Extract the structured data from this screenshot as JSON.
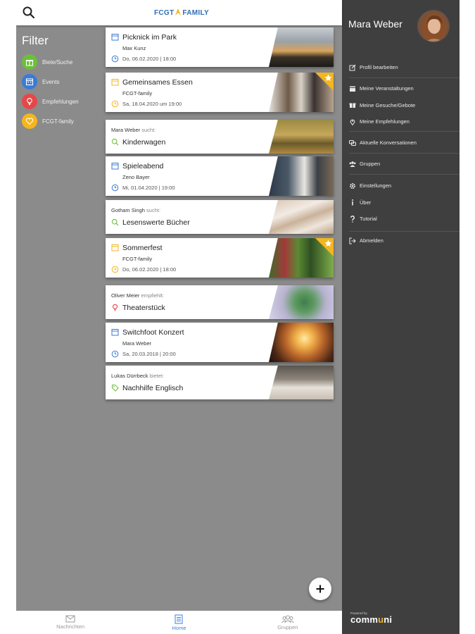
{
  "header": {
    "logo_left": "FCGT",
    "logo_right": "FAMILY",
    "search_icon": "search-icon"
  },
  "filter": {
    "title": "Filter",
    "items": [
      {
        "label": "Biete/Suche",
        "icon": "gift-icon",
        "color": "#6dbf3b"
      },
      {
        "label": "Events",
        "icon": "calendar-icon",
        "color": "#3a7bd5"
      },
      {
        "label": "Empfehlungen",
        "icon": "lightbulb-icon",
        "color": "#e54848"
      },
      {
        "label": "FCGT-family",
        "icon": "heart-icon",
        "color": "#f4b51f"
      }
    ]
  },
  "feed": [
    {
      "type": "event",
      "title": "Picknick im Park",
      "subtitle": "Max Kunz",
      "date": "Do, 06.02.2020 | 18:00"
    },
    {
      "type": "event",
      "title": "Gemeinsames Essen",
      "subtitle": "FCGT-family",
      "date": "Sa, 18.04.2020 um 19:00",
      "starred": true
    },
    {
      "type": "offer",
      "person": "Mara Weber",
      "verb": "sucht:",
      "title": "Kinderwagen"
    },
    {
      "type": "event",
      "title": "Spieleabend",
      "subtitle": "Zeno Bayer",
      "date": "Mi, 01.04.2020 | 19:00"
    },
    {
      "type": "offer",
      "person": "Gotham Singh",
      "verb": "sucht:",
      "title": "Lesenswerte Bücher"
    },
    {
      "type": "event",
      "title": "Sommerfest",
      "subtitle": "FCGT-family",
      "date": "Do, 06.02.2020 | 18:00",
      "starred": true
    },
    {
      "type": "recommend",
      "person": "Oliver Meier",
      "verb": "empfiehlt:",
      "title": "Theaterstück"
    },
    {
      "type": "event",
      "title": "Switchfoot Konzert",
      "subtitle": "Mara Weber",
      "date": "Sa, 20.03.2018 | 20:00"
    },
    {
      "type": "offer-give",
      "person": "Lukas Dürrbeck",
      "verb": "bietet:",
      "title": "Nachhilfe Englisch"
    }
  ],
  "bottom_nav": [
    {
      "label": "Nachrichten",
      "icon": "mail-icon",
      "active": false
    },
    {
      "label": "Home",
      "icon": "list-icon",
      "active": true
    },
    {
      "label": "Gruppen",
      "icon": "group-icon",
      "active": false
    }
  ],
  "drawer": {
    "user_name": "Mara Weber",
    "menu": [
      {
        "label": "Profil bearbeiten",
        "icon": "edit-icon"
      },
      {
        "label": "Meine Veranstaltungen",
        "icon": "calendar-icon"
      },
      {
        "label": "Meine Gesuche/Gebote",
        "icon": "gift-icon"
      },
      {
        "label": "Meine Empfehlungen",
        "icon": "pin-icon"
      },
      {
        "label": "Aktuelle Konversationen",
        "icon": "chat-icon"
      },
      {
        "label": "Gruppen",
        "icon": "group-icon"
      },
      {
        "label": "Einstellungen",
        "icon": "gear-icon"
      },
      {
        "label": "Über",
        "icon": "info-icon"
      },
      {
        "label": "Tutorial",
        "icon": "help-icon"
      },
      {
        "label": "Abmelden",
        "icon": "logout-icon"
      }
    ],
    "powered_by": "Powered by",
    "brand_left": "comm",
    "brand_u": "u",
    "brand_right": "ni"
  },
  "colors": {
    "accent_blue": "#3d7ed8",
    "star_gold": "#f4b51f",
    "drawer_bg": "#3f3f3f",
    "content_bg": "#8b8b8b"
  }
}
